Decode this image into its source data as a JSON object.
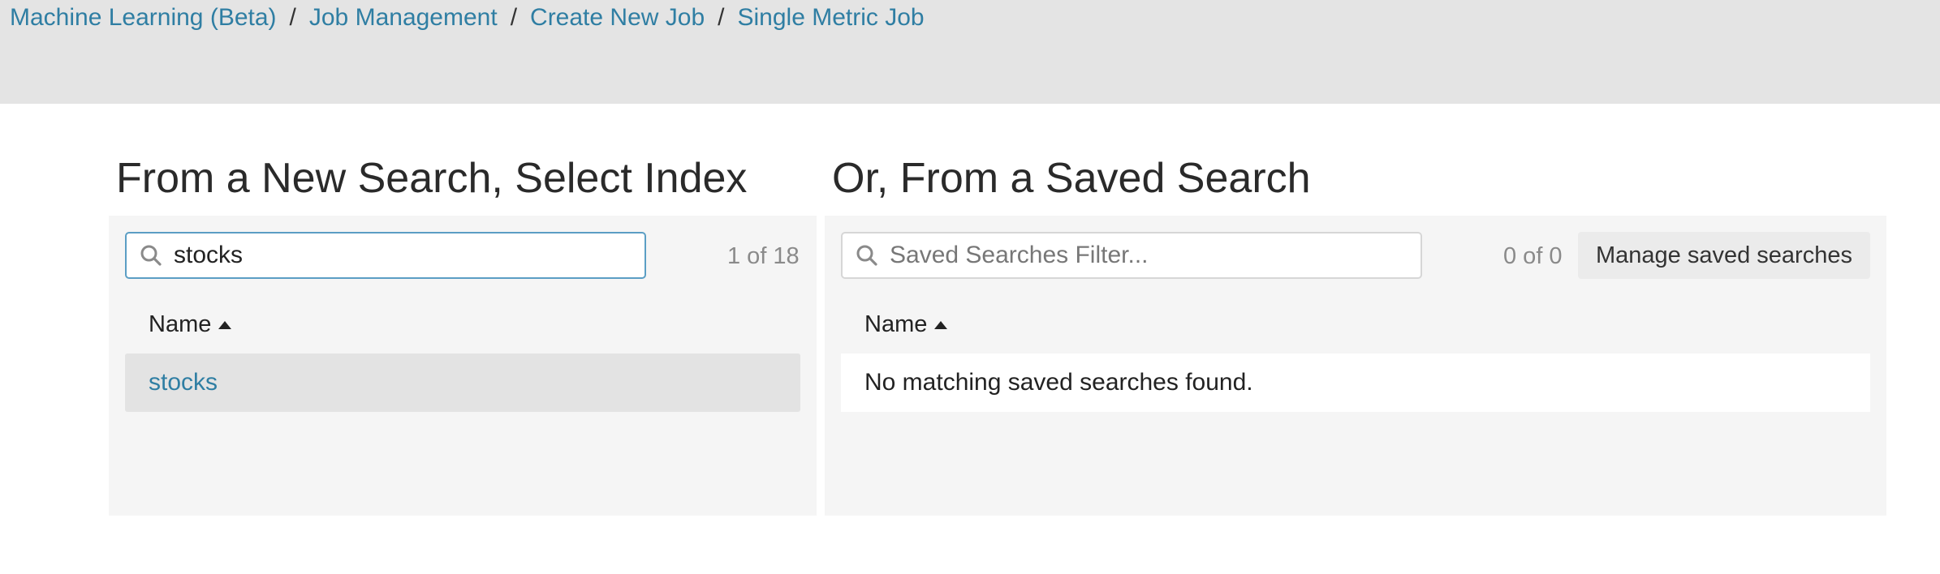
{
  "breadcrumb": {
    "items": [
      "Machine Learning (Beta)",
      "Job Management",
      "Create New Job",
      "Single Metric Job"
    ],
    "separator": "/"
  },
  "left_panel": {
    "title": "From a New Search, Select Index",
    "search": {
      "value": "stocks",
      "placeholder": ""
    },
    "count": "1 of 18",
    "column_header": "Name",
    "rows": [
      "stocks"
    ]
  },
  "right_panel": {
    "title": "Or, From a Saved Search",
    "search": {
      "value": "",
      "placeholder": "Saved Searches Filter..."
    },
    "count": "0 of 0",
    "manage_button": "Manage saved searches",
    "column_header": "Name",
    "empty_message": "No matching saved searches found."
  },
  "icons": {
    "search": "search-icon",
    "sort": "sort-ascending-icon"
  },
  "colors": {
    "link": "#2f7ea3",
    "topbar": "#e4e4e4",
    "panel": "#f5f5f5",
    "focus_border": "#5b9ec4"
  }
}
